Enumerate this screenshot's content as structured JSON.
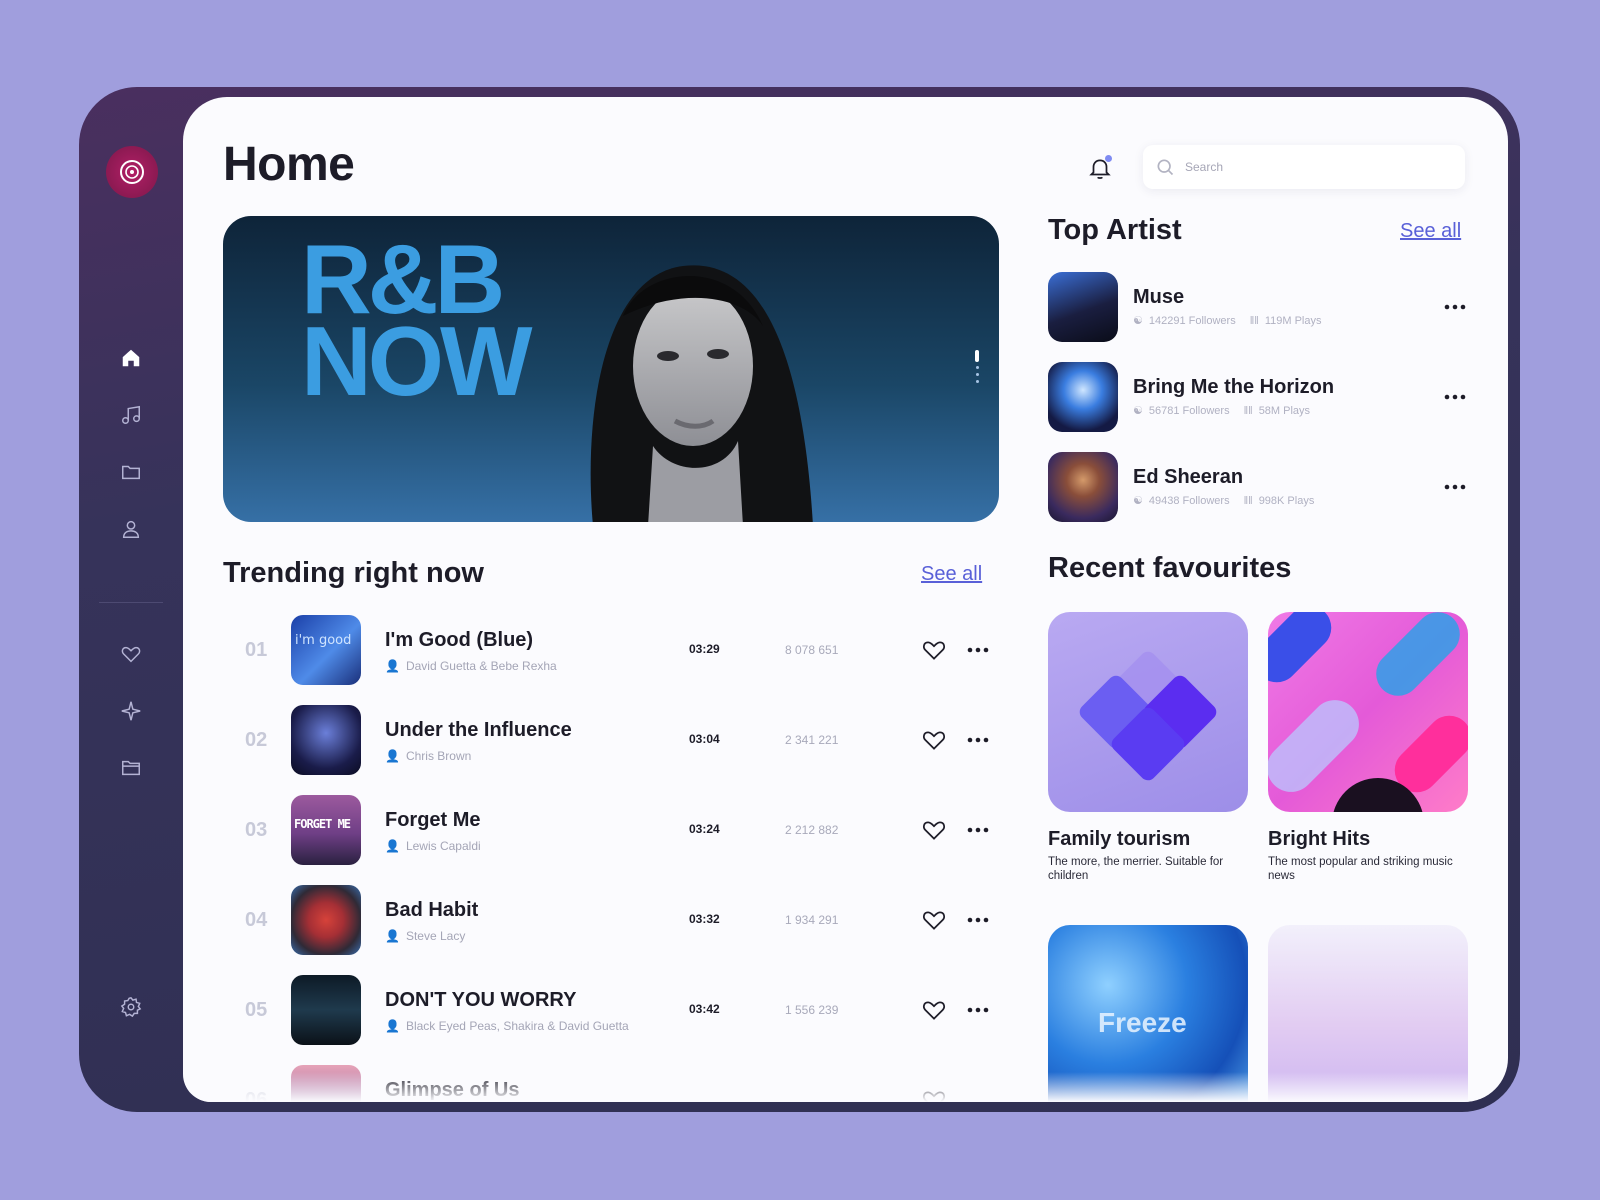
{
  "page": {
    "title": "Home"
  },
  "search": {
    "placeholder": "Search"
  },
  "hero": {
    "line1": "R&B",
    "line2": "NOW"
  },
  "sidebar": {
    "items": [
      {
        "icon": "home-icon"
      },
      {
        "icon": "music-note-icon"
      },
      {
        "icon": "folder-icon"
      },
      {
        "icon": "user-icon"
      },
      {
        "icon": "heart-icon"
      },
      {
        "icon": "sparkle-icon"
      },
      {
        "icon": "folder-icon"
      },
      {
        "icon": "settings-icon"
      }
    ]
  },
  "trending": {
    "title": "Trending right now",
    "see_all": "See all",
    "tracks": [
      {
        "num": "01",
        "title": "I'm Good (Blue)",
        "artist": "David Guetta & Bebe Rexha",
        "duration": "03:29",
        "plays": "8 078 651",
        "cover_text": "i'm good"
      },
      {
        "num": "02",
        "title": "Under the Influence",
        "artist": "Chris Brown",
        "duration": "03:04",
        "plays": "2 341 221",
        "cover_text": ""
      },
      {
        "num": "03",
        "title": "Forget Me",
        "artist": "Lewis Capaldi",
        "duration": "03:24",
        "plays": "2 212 882",
        "cover_text": "FORGET ME"
      },
      {
        "num": "04",
        "title": "Bad Habit",
        "artist": "Steve Lacy",
        "duration": "03:32",
        "plays": "1 934 291",
        "cover_text": ""
      },
      {
        "num": "05",
        "title": "DON'T YOU WORRY",
        "artist": "Black Eyed Peas, Shakira & David Guetta",
        "duration": "03:42",
        "plays": "1 556 239",
        "cover_text": ""
      },
      {
        "num": "06",
        "title": "Glimpse of Us",
        "artist": "",
        "duration": "",
        "plays": "",
        "cover_text": ""
      }
    ]
  },
  "top_artist": {
    "title": "Top Artist",
    "see_all": "See all",
    "artists": [
      {
        "name": "Muse",
        "followers": "142291 Followers",
        "plays": "119M Plays"
      },
      {
        "name": "Bring Me the Horizon",
        "followers": "56781 Followers",
        "plays": "58M Plays"
      },
      {
        "name": "Ed Sheeran",
        "followers": "49438 Followers",
        "plays": "998K Plays"
      }
    ]
  },
  "recent_favourites": {
    "title": "Recent favourites",
    "items": [
      {
        "title": "Family tourism",
        "desc": "The more, the merrier. Suitable for children"
      },
      {
        "title": "Bright Hits",
        "desc": "The most popular and striking music news"
      },
      {
        "title": "",
        "desc": "",
        "art_text": "Freeze"
      },
      {
        "title": "",
        "desc": ""
      }
    ]
  },
  "colors": {
    "accent": "#5960d8",
    "sidebar": "#33325a",
    "logo": "#a01d5d",
    "page_bg": "#a09edd"
  }
}
